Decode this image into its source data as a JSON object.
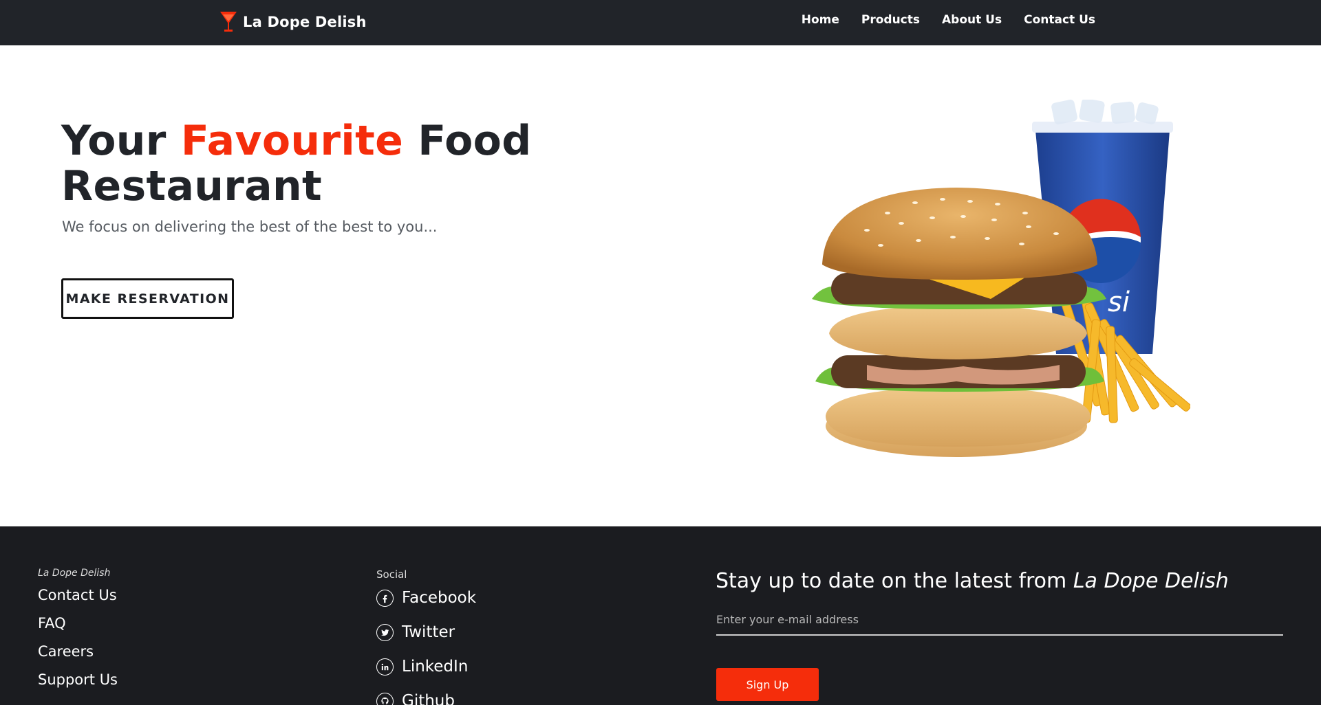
{
  "navbar": {
    "brand": "La Dope Delish",
    "brand_icon": "cocktail-glass-icon",
    "links": [
      {
        "label": "Home"
      },
      {
        "label": "Products"
      },
      {
        "label": "About Us"
      },
      {
        "label": "Contact Us"
      }
    ]
  },
  "hero": {
    "title_part1": "Your ",
    "title_accent": "Favourite",
    "title_part2": " Food Restaurant",
    "subtitle": "We focus on delivering the best of the best to you...",
    "cta_label": "MAKE RESERVATION",
    "image": "burger-fries-pepsi-image"
  },
  "footer": {
    "brand_heading": "La Dope Delish",
    "links": [
      "Contact Us",
      "FAQ",
      "Careers",
      "Support Us"
    ],
    "social_heading": "Social",
    "social": [
      {
        "label": "Facebook",
        "icon": "facebook-icon"
      },
      {
        "label": "Twitter",
        "icon": "twitter-icon"
      },
      {
        "label": "LinkedIn",
        "icon": "linkedin-icon"
      },
      {
        "label": "Github",
        "icon": "github-icon"
      }
    ],
    "newsletter_title": "Stay up to date on the latest from ",
    "newsletter_brand": "La Dope Delish",
    "email_placeholder": "Enter your e-mail address",
    "signup_label": "Sign Up"
  },
  "colors": {
    "accent": "#f52d0b",
    "navbar_bg": "#212429",
    "footer_bg": "#1b1c20",
    "text_dark": "#212429"
  }
}
